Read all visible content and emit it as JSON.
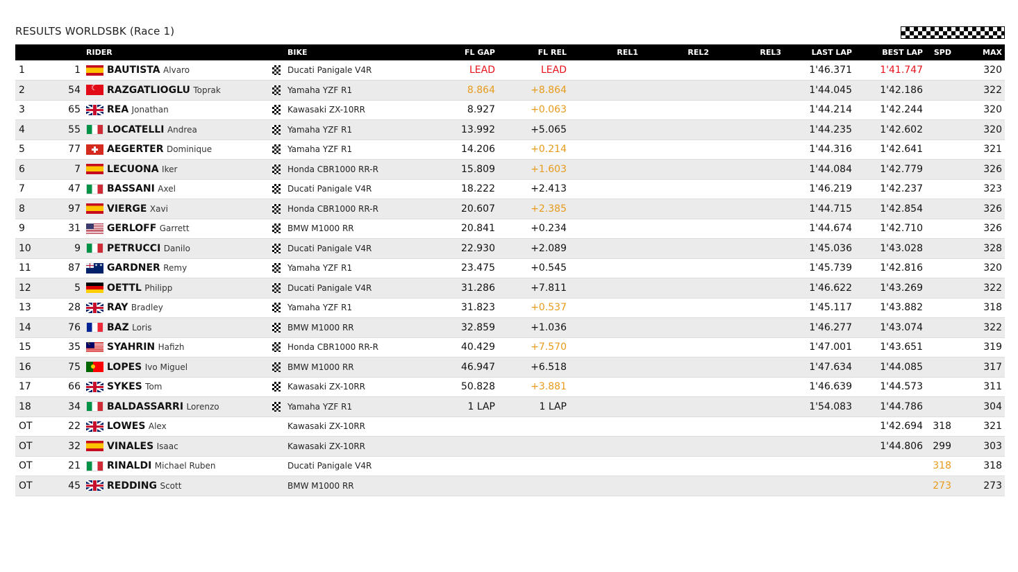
{
  "header": {
    "title": "RESULTS WORLDSBK (Race 1)",
    "banner_icon": "checkered-flag-icon"
  },
  "colors": {
    "header_bg": "#000000",
    "row_alt": "#ebebeb",
    "lead_red": "#e8101a",
    "highlight_orange": "#e89a1a"
  },
  "columns": {
    "rider": "RIDER",
    "bike": "BIKE",
    "fl_gap": "FL GAP",
    "fl_rel": "FL REL",
    "rel1": "REL1",
    "rel2": "REL2",
    "rel3": "REL3",
    "last_lap": "LAST LAP",
    "best_lap": "BEST LAP",
    "spd": "SPD",
    "max": "MAX"
  },
  "rows": [
    {
      "pos": "1",
      "num": "1",
      "flag": "es",
      "surname": "BAUTISTA",
      "first": "Alvaro",
      "finished": true,
      "bike": "Ducati Panigale V4R",
      "fl_gap": "LEAD",
      "fl_gap_color": "red",
      "fl_rel": "LEAD",
      "fl_rel_color": "red",
      "last_lap": "1'46.371",
      "best_lap": "1'41.747",
      "best_lap_color": "red",
      "spd": "",
      "max": "320"
    },
    {
      "pos": "2",
      "num": "54",
      "flag": "tr",
      "surname": "RAZGATLIOGLU",
      "first": "Toprak",
      "finished": true,
      "bike": "Yamaha YZF R1",
      "fl_gap": "8.864",
      "fl_gap_color": "orange",
      "fl_rel": "+8.864",
      "fl_rel_color": "orange",
      "last_lap": "1'44.045",
      "best_lap": "1'42.186",
      "spd": "",
      "max": "322"
    },
    {
      "pos": "3",
      "num": "65",
      "flag": "gb",
      "surname": "REA",
      "first": "Jonathan",
      "finished": true,
      "bike": "Kawasaki ZX-10RR",
      "fl_gap": "8.927",
      "fl_rel": "+0.063",
      "fl_rel_color": "orange",
      "last_lap": "1'44.214",
      "best_lap": "1'42.244",
      "spd": "",
      "max": "320"
    },
    {
      "pos": "4",
      "num": "55",
      "flag": "it",
      "surname": "LOCATELLI",
      "first": "Andrea",
      "finished": true,
      "bike": "Yamaha YZF R1",
      "fl_gap": "13.992",
      "fl_rel": "+5.065",
      "last_lap": "1'44.235",
      "best_lap": "1'42.602",
      "spd": "",
      "max": "320"
    },
    {
      "pos": "5",
      "num": "77",
      "flag": "ch",
      "surname": "AEGERTER",
      "first": "Dominique",
      "finished": true,
      "bike": "Yamaha YZF R1",
      "fl_gap": "14.206",
      "fl_rel": "+0.214",
      "fl_rel_color": "orange",
      "last_lap": "1'44.316",
      "best_lap": "1'42.641",
      "spd": "",
      "max": "321"
    },
    {
      "pos": "6",
      "num": "7",
      "flag": "es",
      "surname": "LECUONA",
      "first": "Iker",
      "finished": true,
      "bike": "Honda CBR1000 RR-R",
      "fl_gap": "15.809",
      "fl_rel": "+1.603",
      "fl_rel_color": "orange",
      "last_lap": "1'44.084",
      "best_lap": "1'42.779",
      "spd": "",
      "max": "326"
    },
    {
      "pos": "7",
      "num": "47",
      "flag": "it",
      "surname": "BASSANI",
      "first": "Axel",
      "finished": true,
      "bike": "Ducati Panigale V4R",
      "fl_gap": "18.222",
      "fl_rel": "+2.413",
      "last_lap": "1'46.219",
      "best_lap": "1'42.237",
      "spd": "",
      "max": "323"
    },
    {
      "pos": "8",
      "num": "97",
      "flag": "es",
      "surname": "VIERGE",
      "first": "Xavi",
      "finished": true,
      "bike": "Honda CBR1000 RR-R",
      "fl_gap": "20.607",
      "fl_rel": "+2.385",
      "fl_rel_color": "orange",
      "last_lap": "1'44.715",
      "best_lap": "1'42.854",
      "spd": "",
      "max": "326"
    },
    {
      "pos": "9",
      "num": "31",
      "flag": "us",
      "surname": "GERLOFF",
      "first": "Garrett",
      "finished": true,
      "bike": "BMW M1000 RR",
      "fl_gap": "20.841",
      "fl_rel": "+0.234",
      "last_lap": "1'44.674",
      "best_lap": "1'42.710",
      "spd": "",
      "max": "326"
    },
    {
      "pos": "10",
      "num": "9",
      "flag": "it",
      "surname": "PETRUCCI",
      "first": "Danilo",
      "finished": true,
      "bike": "Ducati Panigale V4R",
      "fl_gap": "22.930",
      "fl_rel": "+2.089",
      "last_lap": "1'45.036",
      "best_lap": "1'43.028",
      "spd": "",
      "max": "328"
    },
    {
      "pos": "11",
      "num": "87",
      "flag": "au",
      "surname": "GARDNER",
      "first": "Remy",
      "finished": true,
      "bike": "Yamaha YZF R1",
      "fl_gap": "23.475",
      "fl_rel": "+0.545",
      "last_lap": "1'45.739",
      "best_lap": "1'42.816",
      "spd": "",
      "max": "320"
    },
    {
      "pos": "12",
      "num": "5",
      "flag": "de",
      "surname": "OETTL",
      "first": "Philipp",
      "finished": true,
      "bike": "Ducati Panigale V4R",
      "fl_gap": "31.286",
      "fl_rel": "+7.811",
      "last_lap": "1'46.622",
      "best_lap": "1'43.269",
      "spd": "",
      "max": "322"
    },
    {
      "pos": "13",
      "num": "28",
      "flag": "gb",
      "surname": "RAY",
      "first": "Bradley",
      "finished": true,
      "bike": "Yamaha YZF R1",
      "fl_gap": "31.823",
      "fl_rel": "+0.537",
      "fl_rel_color": "orange",
      "last_lap": "1'45.117",
      "best_lap": "1'43.882",
      "spd": "",
      "max": "318"
    },
    {
      "pos": "14",
      "num": "76",
      "flag": "fr",
      "surname": "BAZ",
      "first": "Loris",
      "finished": true,
      "bike": "BMW M1000 RR",
      "fl_gap": "32.859",
      "fl_rel": "+1.036",
      "last_lap": "1'46.277",
      "best_lap": "1'43.074",
      "spd": "",
      "max": "322"
    },
    {
      "pos": "15",
      "num": "35",
      "flag": "my",
      "surname": "SYAHRIN",
      "first": "Hafizh",
      "finished": true,
      "bike": "Honda CBR1000 RR-R",
      "fl_gap": "40.429",
      "fl_rel": "+7.570",
      "fl_rel_color": "orange",
      "last_lap": "1'47.001",
      "best_lap": "1'43.651",
      "spd": "",
      "max": "319"
    },
    {
      "pos": "16",
      "num": "75",
      "flag": "pt",
      "surname": "LOPES",
      "first": "Ivo Miguel",
      "finished": true,
      "bike": "BMW M1000 RR",
      "fl_gap": "46.947",
      "fl_rel": "+6.518",
      "last_lap": "1'47.634",
      "best_lap": "1'44.085",
      "spd": "",
      "max": "317"
    },
    {
      "pos": "17",
      "num": "66",
      "flag": "gb",
      "surname": "SYKES",
      "first": "Tom",
      "finished": true,
      "bike": "Kawasaki ZX-10RR",
      "fl_gap": "50.828",
      "fl_rel": "+3.881",
      "fl_rel_color": "orange",
      "last_lap": "1'46.639",
      "best_lap": "1'44.573",
      "spd": "",
      "max": "311"
    },
    {
      "pos": "18",
      "num": "34",
      "flag": "it",
      "surname": "BALDASSARRI",
      "first": "Lorenzo",
      "finished": true,
      "bike": "Yamaha YZF R1",
      "fl_gap": "1 LAP",
      "fl_rel": "1 LAP",
      "last_lap": "1'54.083",
      "best_lap": "1'44.786",
      "spd": "",
      "max": "304"
    },
    {
      "pos": "OT",
      "num": "22",
      "flag": "gb",
      "surname": "LOWES",
      "first": "Alex",
      "finished": false,
      "bike": "Kawasaki ZX-10RR",
      "fl_gap": "",
      "fl_rel": "",
      "last_lap": "",
      "best_lap": "1'42.694",
      "spd": "318",
      "max": "321"
    },
    {
      "pos": "OT",
      "num": "32",
      "flag": "es",
      "surname": "VINALES",
      "first": "Isaac",
      "finished": false,
      "bike": "Kawasaki ZX-10RR",
      "fl_gap": "",
      "fl_rel": "",
      "last_lap": "",
      "best_lap": "1'44.806",
      "spd": "299",
      "max": "303"
    },
    {
      "pos": "OT",
      "num": "21",
      "flag": "it",
      "surname": "RINALDI",
      "first": "Michael Ruben",
      "finished": false,
      "bike": "Ducati Panigale V4R",
      "fl_gap": "",
      "fl_rel": "",
      "last_lap": "",
      "best_lap": "",
      "spd": "318",
      "spd_color": "orange",
      "max": "318"
    },
    {
      "pos": "OT",
      "num": "45",
      "flag": "gb",
      "surname": "REDDING",
      "first": "Scott",
      "finished": false,
      "bike": "BMW M1000 RR",
      "fl_gap": "",
      "fl_rel": "",
      "last_lap": "",
      "best_lap": "",
      "spd": "273",
      "spd_color": "orange",
      "max": "273"
    }
  ]
}
